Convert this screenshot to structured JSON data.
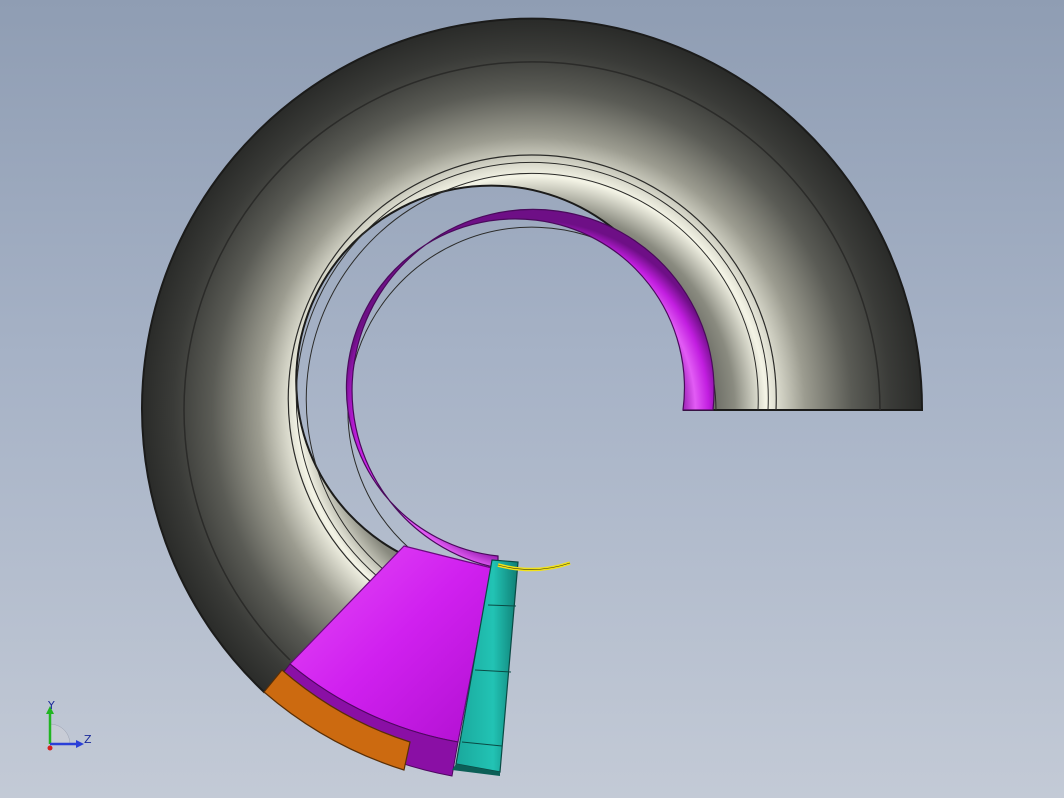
{
  "viewport": {
    "background_top": "#8f9db3",
    "background_bottom": "#c3cad6"
  },
  "model": {
    "parts": [
      {
        "name": "tire-body",
        "color": "#5f605a"
      },
      {
        "name": "rim-ring",
        "color": "#d11ee8"
      },
      {
        "name": "section-segment-magenta",
        "color": "#cc22ee"
      },
      {
        "name": "section-segment-teal",
        "color": "#1fb7aa"
      },
      {
        "name": "section-segment-orange",
        "color": "#cc6a10"
      },
      {
        "name": "yellow-curve",
        "color": "#f2e21a"
      }
    ]
  },
  "triad": {
    "y_label": "Y",
    "z_label": "Z",
    "y_color": "#21b521",
    "z_color": "#2a3fd8",
    "x_color": "#d62020"
  }
}
